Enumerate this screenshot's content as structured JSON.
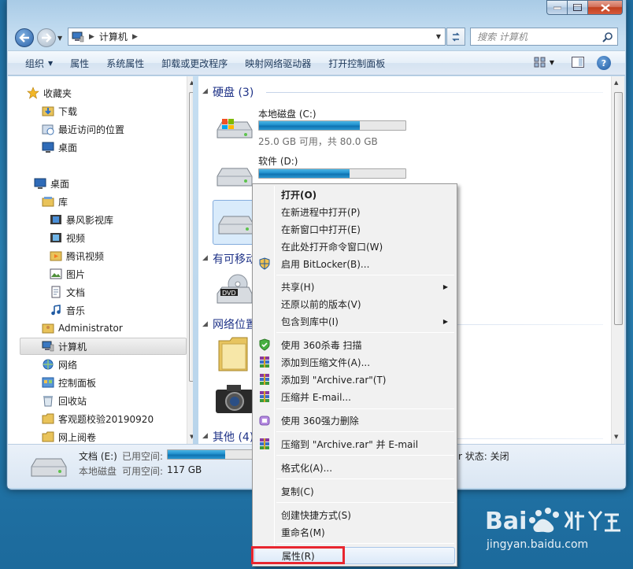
{
  "address": {
    "path_label": "计算机",
    "search_placeholder": "搜索 计算机"
  },
  "toolbar": {
    "organize": "组织",
    "properties": "属性",
    "system_properties": "系统属性",
    "uninstall": "卸载或更改程序",
    "map_drive": "映射网络驱动器",
    "control_panel": "打开控制面板"
  },
  "nav": {
    "favorites": "收藏夹",
    "downloads": "下载",
    "recent": "最近访问的位置",
    "desktop_fav": "桌面",
    "desktop": "桌面",
    "libraries": "库",
    "baofeng": "暴风影视库",
    "videos": "视频",
    "tencent": "腾讯视频",
    "pictures": "图片",
    "documents": "文档",
    "music": "音乐",
    "admin": "Administrator",
    "computer": "计算机",
    "network": "网络",
    "control_panel": "控制面板",
    "recycle": "回收站",
    "folder1": "客观题校验20190920",
    "folder2": "网上阅卷"
  },
  "content": {
    "hdd_header": "硬盘 (3)",
    "removable_header": "有可移动",
    "network_header": "网络位置",
    "other_header": "其他 (4)",
    "drive_c": {
      "name": "本地磁盘 (C:)",
      "space": "25.0 GB 可用，共 80.0 GB",
      "used_fraction": 0.69
    },
    "drive_d": {
      "name": "软件 (D:)",
      "used_fraction": 0.62
    },
    "drive_e": {
      "used_fraction": 0.5
    }
  },
  "details": {
    "name": "文档 (E:)",
    "used_label": "已用空间:",
    "type": "本地磁盘",
    "free_label": "可用空间:",
    "free_value": "117 GB",
    "bitlocker_tail": "r 状态: 关闭",
    "used_fraction": 0.62
  },
  "menu": {
    "open": "打开(O)",
    "open_new_process": "在新进程中打开(P)",
    "open_new_window": "在新窗口中打开(E)",
    "open_cmd": "在此处打开命令窗口(W)",
    "bitlocker": "启用 BitLocker(B)...",
    "share": "共享(H)",
    "restore": "还原以前的版本(V)",
    "include_library": "包含到库中(I)",
    "scan_360": "使用 360杀毒 扫描",
    "add_archive": "添加到压缩文件(A)...",
    "add_archive_rar": "添加到 \"Archive.rar\"(T)",
    "compress_email": "压缩并 E-mail...",
    "delete_360": "使用 360强力删除",
    "compress_rar_email": "压缩到 \"Archive.rar\" 并 E-mail",
    "format": "格式化(A)...",
    "copy": "复制(C)",
    "create_shortcut": "创建快捷方式(S)",
    "rename": "重命名(M)",
    "properties": "属性(R)"
  },
  "watermark": {
    "url": "jingyan.baidu.com"
  },
  "icons": {
    "colors": {
      "accent_blue": "#1e3287",
      "highlight_red": "#e8262f"
    }
  }
}
